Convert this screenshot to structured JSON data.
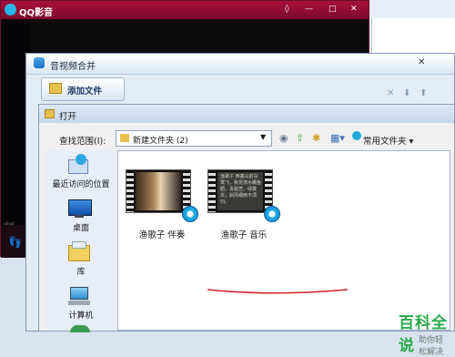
{
  "qq_window": {
    "title": "QQ影音",
    "controls": [
      "◊",
      "—",
      "□",
      "✕"
    ]
  },
  "merge_window": {
    "title": "音视频合并",
    "close": "✕",
    "add_file_label": "添加文件",
    "toolbar_icons": [
      "delete-icon",
      "move-down-icon",
      "move-up-icon"
    ]
  },
  "open_dialog": {
    "title": "打开",
    "lookin_label": "查找范围(I):",
    "lookin_value": "新建文件夹 (2)",
    "favorites_label": "常用文件夹",
    "places": [
      {
        "label": "最近访问的位置",
        "icon": "recent-places-icon"
      },
      {
        "label": "桌面",
        "icon": "desktop-icon"
      },
      {
        "label": "库",
        "icon": "libraries-icon"
      },
      {
        "label": "计算机",
        "icon": "computer-icon"
      }
    ],
    "files": [
      {
        "name": "渔歌子 伴奏",
        "thumb": "video-thumbnail-1"
      },
      {
        "name": "渔歌子 音乐",
        "thumb": "video-thumbnail-2",
        "thumb_text": "渔歌子 西塞山前白鹭飞，桃花流水鳜鱼肥。青箬笠，绿蓑衣，斜风细雨不须归。"
      }
    ]
  },
  "watermark": {
    "big": "百科全说",
    "small": "助你轻松解决"
  },
  "colors": {
    "qq_title": "#a6103c",
    "underline": "#d2202a",
    "watermark": "#28a84a"
  }
}
